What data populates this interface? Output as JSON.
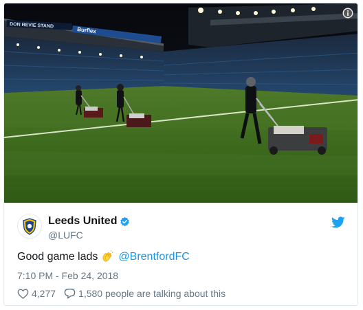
{
  "author": {
    "name": "Leeds United",
    "handle": "@LUFC"
  },
  "tweet": {
    "text": "Good game lads",
    "mention": "@BrentfordFC",
    "timestamp": "7:10 PM - Feb 24, 2018"
  },
  "stats": {
    "likes": "4,277",
    "talking": "1,580 people are talking about this"
  },
  "photo": {
    "stand_sign": "DON REVIE STAND",
    "sponsor_sign": "Burflex"
  },
  "icons": {
    "verified": "verified-badge-icon",
    "bird": "twitter-bird-icon",
    "heart": "heart-icon",
    "reply": "reply-bubble-icon",
    "info": "info-icon",
    "clap": "clapping-hands-icon"
  },
  "colors": {
    "link": "#1b95e0",
    "text": "#14171a",
    "muted": "#657786",
    "border": "#e1e8ed",
    "pitch": "#3f6b1f"
  }
}
